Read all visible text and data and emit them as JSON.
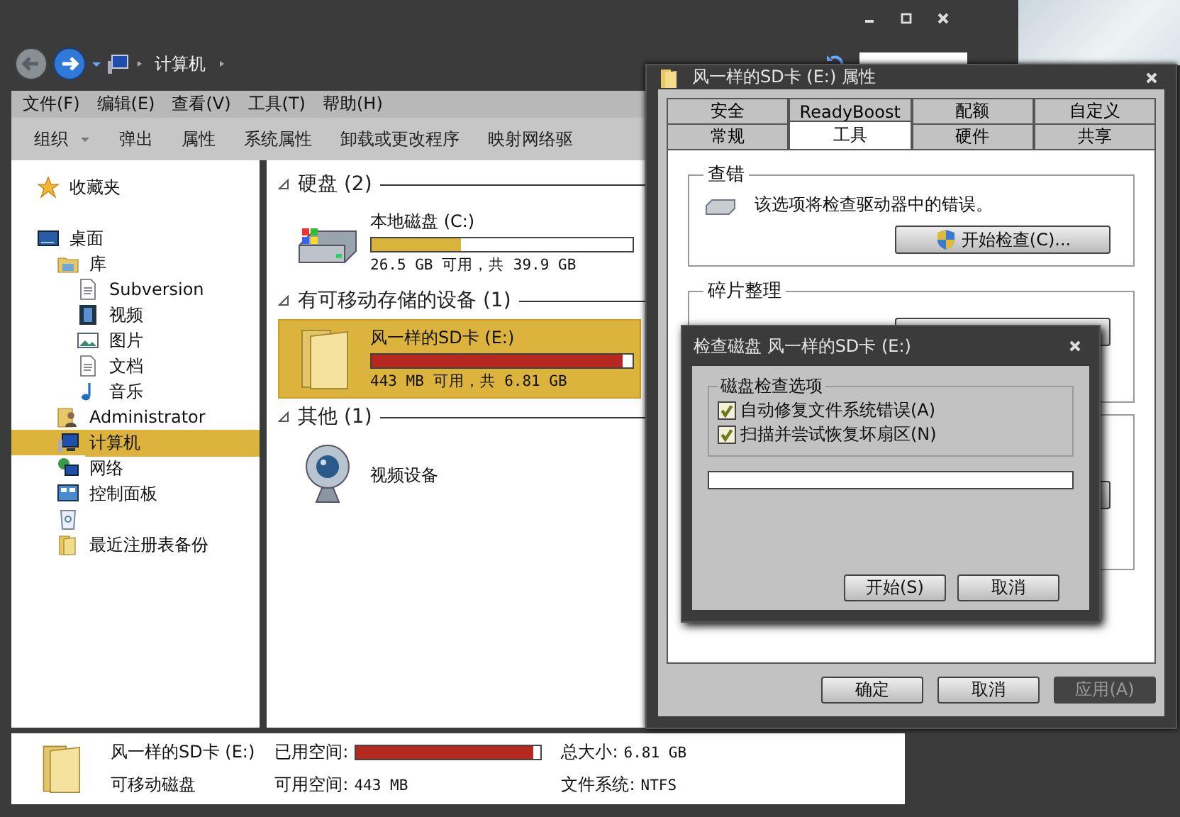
{
  "explorer": {
    "breadcrumb": [
      "计算机"
    ],
    "menu": [
      "文件(F)",
      "编辑(E)",
      "查看(V)",
      "工具(T)",
      "帮助(H)"
    ],
    "toolbar": [
      {
        "label": "组织",
        "dropdown": true
      },
      {
        "label": "弹出",
        "dropdown": false
      },
      {
        "label": "属性",
        "dropdown": false
      },
      {
        "label": "系统属性",
        "dropdown": false
      },
      {
        "label": "卸载或更改程序",
        "dropdown": false
      },
      {
        "label": "映射网络驱",
        "dropdown": false
      }
    ],
    "nav": [
      {
        "label": "收藏夹",
        "kind": "star",
        "selected": false
      },
      {
        "label": "桌面",
        "kind": "desktop",
        "selected": false,
        "children": [
          {
            "label": "库",
            "kind": "library",
            "selected": false,
            "children": [
              {
                "label": "Subversion",
                "kind": "document",
                "selected": false
              },
              {
                "label": "视频",
                "kind": "video",
                "selected": false
              },
              {
                "label": "图片",
                "kind": "picture",
                "selected": false
              },
              {
                "label": "文档",
                "kind": "document",
                "selected": false
              },
              {
                "label": "音乐",
                "kind": "music",
                "selected": false
              }
            ]
          },
          {
            "label": "Administrator",
            "kind": "user",
            "selected": false
          },
          {
            "label": "计算机",
            "kind": "computer",
            "selected": true
          },
          {
            "label": "网络",
            "kind": "network",
            "selected": false
          },
          {
            "label": "控制面板",
            "kind": "control",
            "selected": false
          },
          {
            "kind": "recycle",
            "selected": false
          },
          {
            "label": "最近注册表备份",
            "kind": "folder",
            "selected": false
          }
        ]
      }
    ],
    "groups": [
      {
        "title": "硬盘 (2)",
        "items": [
          {
            "name": "本地磁盘 (C:)",
            "detail": "26.5 GB 可用，共 39.9 GB",
            "kind": "drive",
            "level": 0.34,
            "selected": false
          }
        ]
      },
      {
        "title": "有可移动存储的设备 (1)",
        "items": [
          {
            "name": "风一样的SD卡 (E:)",
            "detail": "443 MB 可用，共 6.81 GB",
            "kind": "folder",
            "level": 0.96,
            "selected": true
          }
        ]
      },
      {
        "title": "其他 (1)",
        "items": [
          {
            "name": "视频设备",
            "kind": "webcam"
          }
        ]
      }
    ],
    "details": {
      "name": "风一样的SD卡 (E:)",
      "type": "可移动磁盘",
      "used_label": "已用空间:",
      "used": {
        "level": 0.96
      },
      "free_label": "可用空间:",
      "free_value": "443 MB",
      "total_label": "总大小:",
      "total_value": "6.81 GB",
      "fs_label": "文件系统:",
      "fs_value": "NTFS"
    }
  },
  "properties": {
    "title": "风一样的SD卡 (E:) 属性",
    "tab_rows": [
      [
        {
          "label": "安全",
          "selected": false
        },
        {
          "label": "ReadyBoost",
          "selected": false
        },
        {
          "label": "配额",
          "selected": false
        },
        {
          "label": "自定义",
          "selected": false
        }
      ],
      [
        {
          "label": "常规",
          "selected": false
        },
        {
          "label": "工具",
          "selected": true
        },
        {
          "label": "硬件",
          "selected": false
        },
        {
          "label": "共享",
          "selected": false
        }
      ]
    ],
    "error_check": {
      "title": "查错",
      "text": "该选项将检查驱动器中的错误。",
      "button": "开始检查(C)..."
    },
    "defrag": {
      "title": "碎片整理"
    },
    "buttons": [
      {
        "label": "确定",
        "disabled": false
      },
      {
        "label": "取消",
        "disabled": false
      },
      {
        "label": "应用(A)",
        "disabled": true
      }
    ]
  },
  "check_disk": {
    "title": "检查磁盘 风一样的SD卡 (E:)",
    "group": "磁盘检查选项",
    "options": [
      {
        "label": "自动修复文件系统错误(A)",
        "checked": true
      },
      {
        "label": "扫描并尝试恢复坏扇区(N)",
        "checked": true
      }
    ],
    "progress": {
      "level": 0
    },
    "buttons": [
      "开始(S)",
      "取消"
    ]
  }
}
